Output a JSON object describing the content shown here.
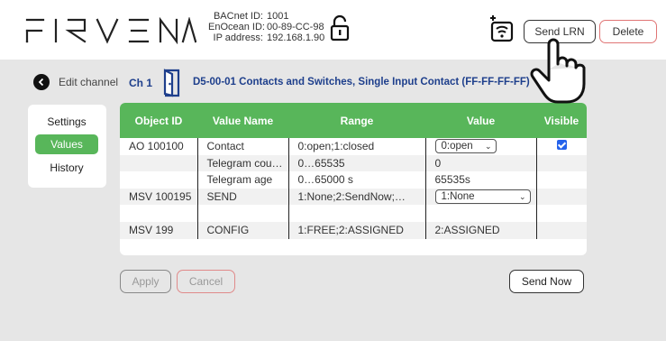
{
  "header": {
    "logo_text": "FIRVENA",
    "bacnet_label": "BACnet ID:",
    "bacnet_value": "1001",
    "enocean_label": "EnOcean ID:",
    "enocean_value": "00-89-CC-98",
    "ip_label": "IP address:",
    "ip_value": "192.168.1.90",
    "send_lrn_label": "Send LRN",
    "delete_label": "Delete"
  },
  "breadcrumb": {
    "back_label": "Edit channel",
    "channel": "Ch 1",
    "profile": "D5-00-01 Contacts and Switches, Single Input Contact (FF-FF-FF-FF)"
  },
  "sidebar": {
    "items": [
      {
        "label": "Settings",
        "active": false
      },
      {
        "label": "Values",
        "active": true
      },
      {
        "label": "History",
        "active": false
      }
    ]
  },
  "table": {
    "columns": [
      "Object ID",
      "Value Name",
      "Range",
      "Value",
      "Visible"
    ],
    "rows": [
      {
        "object_id": "AO 100100",
        "name": "Contact",
        "range": "0:open;1:closed",
        "value": "0:open",
        "value_type": "select",
        "visible": true
      },
      {
        "object_id": "",
        "name": "Telegram counter",
        "range": "0…65535",
        "value": "0",
        "value_type": "text",
        "visible": false
      },
      {
        "object_id": "",
        "name": "Telegram age",
        "range": "0…65000 s",
        "value": "65535s",
        "value_type": "text",
        "visible": false
      },
      {
        "object_id": "MSV 100195",
        "name": "SEND",
        "range": "1:None;2:SendNow;…",
        "value": "1:None",
        "value_type": "select",
        "visible": false
      },
      {
        "object_id": "",
        "name": "",
        "range": "",
        "value": "",
        "value_type": "text",
        "visible": false
      },
      {
        "object_id": "MSV 199",
        "name": "CONFIG",
        "range": "1:FREE;2:ASSIGNED",
        "value": "2:ASSIGNED",
        "value_type": "text",
        "visible": false
      }
    ]
  },
  "actions": {
    "apply_label": "Apply",
    "cancel_label": "Cancel",
    "send_now_label": "Send Now"
  },
  "colors": {
    "accent_green": "#58b65a",
    "title_blue": "#1e3f8c",
    "delete_red": "#e07575",
    "checkbox_blue": "#2563eb"
  }
}
